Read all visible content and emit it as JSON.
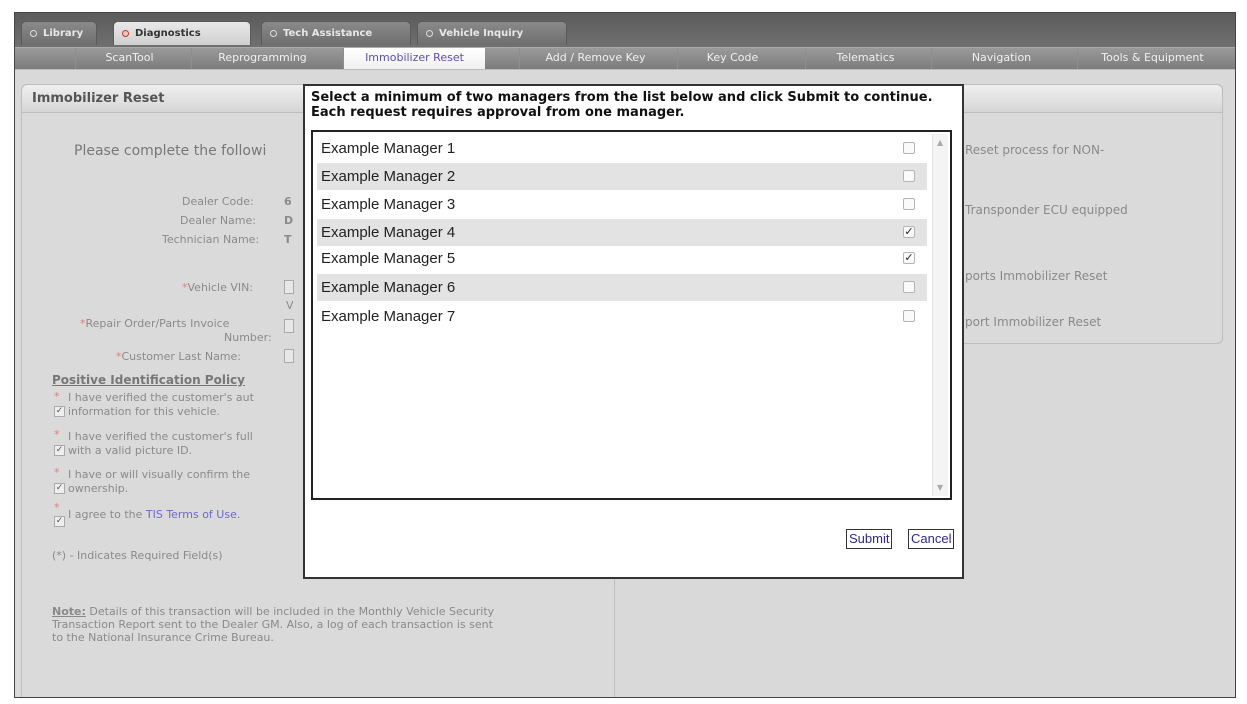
{
  "top_tabs": [
    {
      "label": "Library"
    },
    {
      "label": "Diagnostics"
    },
    {
      "label": "Tech Assistance"
    },
    {
      "label": "Vehicle Inquiry"
    }
  ],
  "sub_nav": [
    {
      "label": "ScanTool"
    },
    {
      "label": "Reprogramming"
    },
    {
      "label": "Immobilizer Reset"
    },
    {
      "label": "Add / Remove Key"
    },
    {
      "label": "Key Code"
    },
    {
      "label": "Telematics"
    },
    {
      "label": "Navigation"
    },
    {
      "label": "Tools & Equipment"
    }
  ],
  "left_panel": {
    "title": "Immobilizer Reset",
    "intro": "Please complete the followi",
    "dealer_code_label": "Dealer Code:",
    "dealer_code_value": "6",
    "dealer_name_label": "Dealer Name:",
    "dealer_name_value": "D",
    "technician_label": "Technician Name:",
    "technician_value": "T",
    "vin_label": "Vehicle VIN:",
    "vin_sub": "V",
    "repair_label_1": "Repair Order/Parts Invoice",
    "repair_label_2": "Number:",
    "customer_label": "Customer Last Name:",
    "policy_heading": "Positive Identification Policy",
    "policy_1a": "I have verified the customer's aut",
    "policy_1b": "information for this vehicle.",
    "policy_2a": "I have verified the customer's full",
    "policy_2b": "with a valid picture ID.",
    "policy_3a": "I have or will visually confirm the",
    "policy_3b": "ownership.",
    "policy_4_prefix": "I agree to the ",
    "policy_4_link": "TIS Terms of Use.",
    "required_note": "(*) - Indicates Required Field(s)",
    "note_label": "Note:",
    "note_text_1": " Details of this transaction will be included in the Monthly Vehicle Security",
    "note_text_2": "Transaction Report sent to the Dealer GM. Also, a log of each transaction is sent",
    "note_text_3": "to the National Insurance Crime Bureau."
  },
  "right_panel": {
    "line_1": "Reset process for NON-",
    "line_2": "Transponder ECU equipped",
    "line_3": "ports Immobilizer Reset",
    "line_4": "port Immobilizer Reset"
  },
  "modal": {
    "instruction": "Select a minimum of two managers from the list below and click Submit to continue. Each request requires approval from one manager.",
    "managers": [
      {
        "name": "Example Manager 1",
        "checked": false
      },
      {
        "name": "Example Manager 2",
        "checked": false
      },
      {
        "name": "Example Manager 3",
        "checked": false
      },
      {
        "name": "Example Manager 4",
        "checked": true
      },
      {
        "name": "Example Manager 5",
        "checked": true
      },
      {
        "name": "Example Manager 6",
        "checked": false
      },
      {
        "name": "Example Manager 7",
        "checked": false
      }
    ],
    "submit_label": "Submit",
    "cancel_label": "Cancel"
  },
  "colors": {
    "accent": "#5a4fb0",
    "required": "#d98080",
    "link": "#6a6ac8"
  },
  "icons": [
    "radio-dot-icon",
    "checkbox-icon",
    "scroll-up-icon",
    "scroll-down-icon"
  ]
}
